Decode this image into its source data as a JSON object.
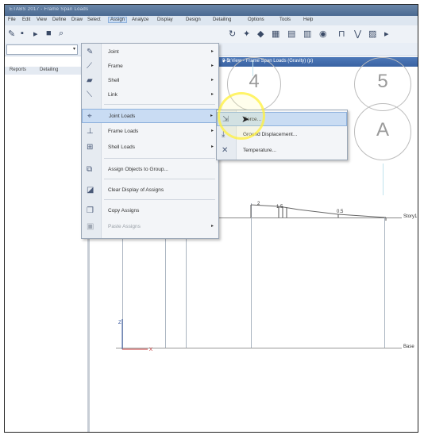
{
  "window": {
    "title": "ETABS 2017 - Frame Span Loads"
  },
  "menubar": {
    "items": [
      "File",
      "Edit",
      "View",
      "Define",
      "Draw",
      "Select",
      "Assign",
      "Analyze",
      "Display",
      "Design",
      "Detailing",
      "Options",
      "Tools",
      "Help"
    ]
  },
  "tabs": [
    "Reports",
    "Detailing"
  ],
  "view": {
    "title": "3-D View - Frame Span Loads (Gravity) (p)"
  },
  "assign_menu": {
    "items": [
      {
        "label": "Joint",
        "icon": "joint-icon",
        "submenu": true
      },
      {
        "label": "Frame",
        "icon": "frame-icon",
        "submenu": true
      },
      {
        "label": "Shell",
        "icon": "shell-icon",
        "submenu": true
      },
      {
        "label": "Link",
        "icon": "link-icon",
        "submenu": true
      },
      {
        "label": "Joint Loads",
        "icon": "joint-loads-icon",
        "submenu": true,
        "highlighted": true
      },
      {
        "label": "Frame Loads",
        "icon": "frame-loads-icon",
        "submenu": true
      },
      {
        "label": "Shell Loads",
        "icon": "shell-loads-icon",
        "submenu": true
      },
      {
        "label": "Assign Objects to Group...",
        "icon": "group-icon",
        "submenu": false
      },
      {
        "label": "Clear Display of Assigns",
        "icon": "clear-icon",
        "submenu": false
      },
      {
        "label": "Copy Assigns",
        "icon": "copy-icon",
        "submenu": false
      },
      {
        "label": "Paste Assigns",
        "icon": "paste-icon",
        "submenu": true
      }
    ]
  },
  "joint_loads_submenu": {
    "items": [
      {
        "label": "Force...",
        "icon": "force-icon",
        "highlighted": true
      },
      {
        "label": "Ground Displacement...",
        "icon": "ground-displacement-icon"
      },
      {
        "label": "Temperature...",
        "icon": "temperature-icon"
      }
    ]
  },
  "drawing": {
    "grid_bubbles": [
      "4",
      "5",
      "A"
    ],
    "load_labels": [
      "2",
      "1.5",
      "0.5"
    ],
    "story_labels": [
      "Story1",
      "Base"
    ]
  }
}
